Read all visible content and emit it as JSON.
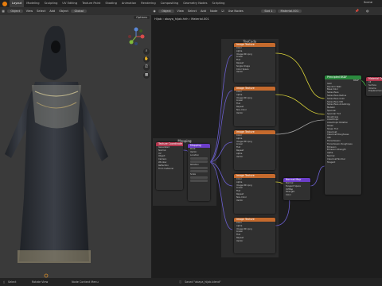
{
  "topbar": {
    "tabs": [
      "Layout",
      "Modeling",
      "Sculpting",
      "UV Editing",
      "Texture Paint",
      "Shading",
      "Animation",
      "Rendering",
      "Compositing",
      "Geometry Nodes",
      "Scripting"
    ],
    "active_tab": "Layout",
    "scene": "Scene"
  },
  "viewport_toolbar": {
    "mode": "Object",
    "items": [
      "View",
      "Select",
      "Add",
      "Object"
    ],
    "transform": "Global",
    "options": "Options"
  },
  "node_toolbar": {
    "editor": "Object",
    "items": [
      "View",
      "Select",
      "Add",
      "Node"
    ],
    "use_nodes": "Use Nodes",
    "slot": "Slot 1",
    "material": "Material.001"
  },
  "breadcrumb": {
    "obj": "Hijab",
    "mesh": "abaya_hijab.hhh",
    "material": "Material.001"
  },
  "frames": {
    "textures": "TexCoda",
    "mapping": "Mapping"
  },
  "nodes": {
    "texcoord": {
      "title": "Texture Coordinate",
      "outputs": [
        "Generated",
        "Normal",
        "UV",
        "Object",
        "Camera",
        "Window",
        "Reflection"
      ],
      "from_instancer": "From Instancer"
    },
    "mapping": {
      "title": "Mapping",
      "type": "Point",
      "inputs": [
        "Vector",
        "Location",
        "Rotation",
        "Scale"
      ]
    },
    "image_tex": {
      "title": "Image Texture",
      "outputs": [
        "Color",
        "Alpha"
      ],
      "file": "Image.001.png",
      "settings": [
        "Linear",
        "Flat",
        "Repeat",
        "Single Image",
        "Color Space",
        "Alpha",
        "Non-Color"
      ],
      "vector": "Vector"
    },
    "bsdf": {
      "title": "Principled BSDF",
      "outputs": [
        "BSDF"
      ],
      "rows": [
        "GGX",
        "Random Walk",
        "Base Color",
        "Subsurface",
        "Subsurface Radius",
        "Subsurface Color",
        "Subsurface IOR",
        "Subsurface Anisotropy",
        "Metallic",
        "Specular",
        "Specular Tint",
        "Roughness",
        "Anisotropic",
        "Anisotropic Rotation",
        "Sheen",
        "Sheen Tint",
        "Clearcoat",
        "Clearcoat Roughness",
        "IOR",
        "Transmission",
        "Transmission Roughness",
        "Emission",
        "Emission Strength",
        "Alpha",
        "Normal",
        "Clearcoat Normal",
        "Tangent"
      ]
    },
    "output": {
      "title": "Material Output",
      "rows": [
        "All",
        "Surface",
        "Volume",
        "Displacement"
      ]
    },
    "normal": {
      "title": "Normal Map",
      "rows": [
        "Normal",
        "Tangent Space",
        "UVMap",
        "Strength",
        "Color"
      ]
    }
  },
  "statusbar": {
    "left": "Select",
    "mid": "Rotate View",
    "right": "Node Context Menu",
    "saved": "Saved \"abaya_hijab.blend\""
  },
  "colors": {
    "tex_header": "#c56a2d",
    "vec_header": "#6c3ec9",
    "input_header": "#b2364d",
    "shader_header": "#2b8a3e",
    "wire_yellow": "#d8d23a",
    "wire_purple": "#6b5fd0"
  }
}
